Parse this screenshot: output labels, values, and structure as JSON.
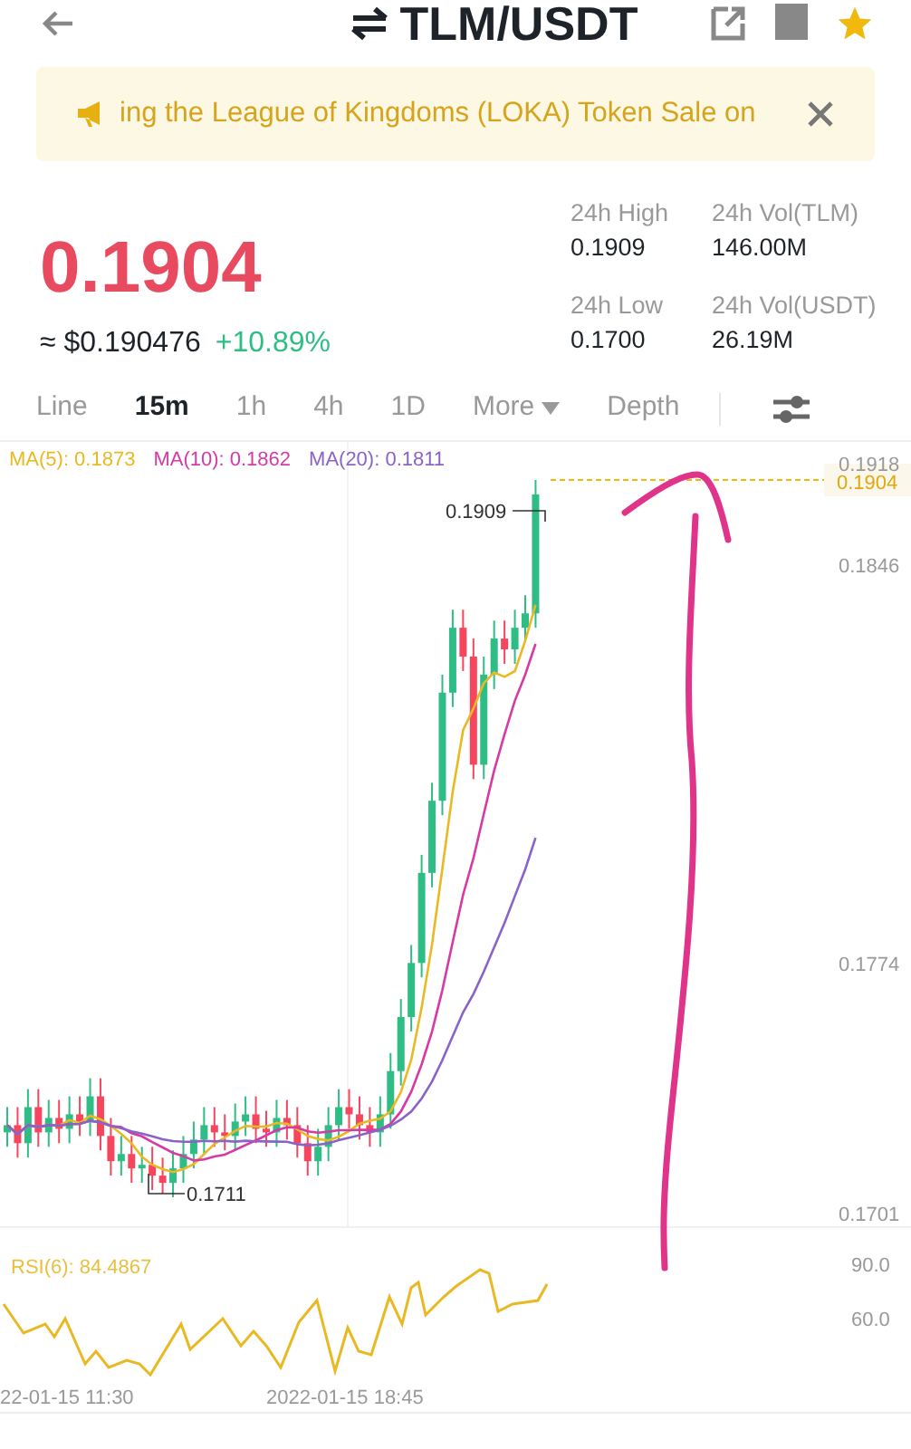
{
  "header": {
    "title": "TLM/USDT"
  },
  "banner": {
    "text": "ing the League of Kingdoms (LOKA) Token Sale on"
  },
  "price": {
    "last": "0.1904",
    "usd": "≈ $0.190476",
    "change": "+10.89%"
  },
  "stats": [
    {
      "label": "24h High",
      "value": "0.1909"
    },
    {
      "label": "24h Vol(TLM)",
      "value": "146.00M"
    },
    {
      "label": "24h Low",
      "value": "0.1700"
    },
    {
      "label": "24h Vol(USDT)",
      "value": "26.19M"
    }
  ],
  "intervals": [
    {
      "label": "Line",
      "selected": false,
      "kind": "tab"
    },
    {
      "label": "15m",
      "selected": true,
      "kind": "tab"
    },
    {
      "label": "1h",
      "selected": false,
      "kind": "tab"
    },
    {
      "label": "4h",
      "selected": false,
      "kind": "tab"
    },
    {
      "label": "1D",
      "selected": false,
      "kind": "tab"
    },
    {
      "label": "More",
      "selected": false,
      "kind": "dropdown"
    },
    {
      "label": "Depth",
      "selected": false,
      "kind": "tab"
    }
  ],
  "chart": {
    "indicators": [
      {
        "label": "MA(5): 0.1873",
        "color": "#e8b923"
      },
      {
        "label": "MA(10): 0.1862",
        "color": "#d63aa5"
      },
      {
        "label": "MA(20): 0.1811",
        "color": "#8a63c7"
      }
    ],
    "price_ticks": [
      "0.1918",
      "0.1846",
      "0.1774",
      "0.1701"
    ],
    "last_price_tag": "0.1904",
    "high_label": "0.1909",
    "low_label": "0.1711"
  },
  "rsi": {
    "label": "RSI(6): 84.4867",
    "ticks": [
      "90.0",
      "60.0"
    ]
  },
  "time_labels": [
    "22-01-15 11:30",
    "2022-01-15 18:45"
  ]
}
